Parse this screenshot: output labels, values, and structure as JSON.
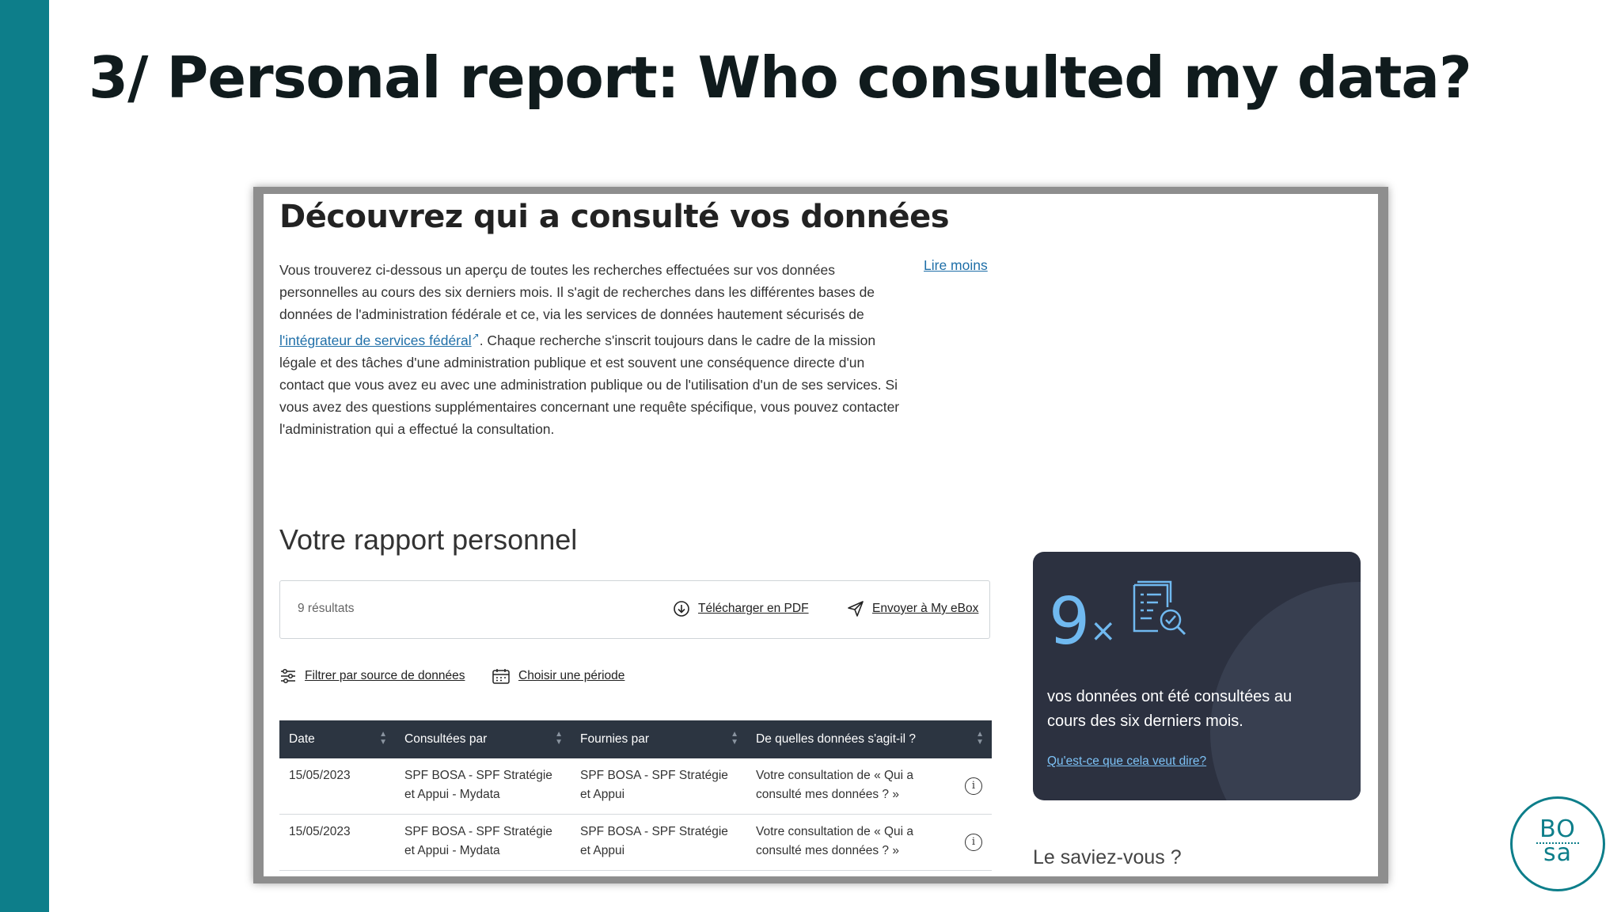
{
  "slide": {
    "title": "3/ Personal report: Who consulted my data?",
    "accent_color": "#0d7e8a"
  },
  "page": {
    "heading": "Découvrez qui a consulté vos données",
    "intro_part1": "Vous trouverez ci-dessous un aperçu de toutes les recherches effectuées sur vos données personnelles au cours des six derniers mois. Il s'agit de recherches dans les différentes bases de données de l'administration fédérale et ce, via les services de données hautement sécurisés de ",
    "intro_link": "l'intégrateur de services fédéral",
    "intro_part2": ". Chaque recherche s'inscrit toujours dans le cadre de la mission légale et des tâches d'une administration publique et est souvent une conséquence directe d'un contact que vous avez eu avec une administration publique ou de l'utilisation d'un de ses services. Si vous avez des questions supplémentaires concernant une requête spécifique, vous pouvez contacter l'administration qui a effectué la consultation.",
    "read_less": "Lire moins",
    "report_title": "Votre rapport personnel",
    "results_count": "9 résultats",
    "download_pdf": "Télécharger en PDF",
    "send_ebox": "Envoyer à My eBox",
    "filter_source": "Filtrer par source de données",
    "choose_period": "Choisir une période"
  },
  "table": {
    "headers": [
      "Date",
      "Consultées par",
      "Fournies par",
      "De quelles données s'agit-il ?"
    ],
    "rows": [
      {
        "date": "15/05/2023",
        "consulted_by": [
          "SPF BOSA - SPF Stratégie",
          "et Appui - Mydata"
        ],
        "provided_by": [
          "SPF BOSA - SPF Stratégie",
          "et Appui"
        ],
        "data": [
          "Votre consultation de « Qui a",
          "consulté mes données ? »"
        ]
      },
      {
        "date": "15/05/2023",
        "consulted_by": [
          "SPF BOSA - SPF Stratégie",
          "et Appui - Mydata"
        ],
        "provided_by": [
          "SPF BOSA - SPF Stratégie",
          "et Appui"
        ],
        "data": [
          "Votre consultation de « Qui a",
          "consulté mes données ? »"
        ]
      }
    ]
  },
  "card": {
    "count": "9",
    "times": "×",
    "text": "vos données ont été consultées au cours des six derniers mois.",
    "link": "Qu'est-ce que cela veut dire?",
    "background": "#2c3140",
    "count_color": "#70b9f0"
  },
  "did_you_know": "Le saviez-vous ?",
  "logo": {
    "line1": "BO",
    "line2": "sa"
  }
}
